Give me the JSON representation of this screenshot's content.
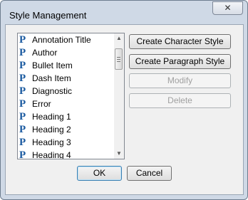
{
  "window": {
    "title": "Style Management",
    "close_label": "✕"
  },
  "styles_list": {
    "items": [
      {
        "icon": "P",
        "label": "Annotation Title"
      },
      {
        "icon": "P",
        "label": "Author"
      },
      {
        "icon": "P",
        "label": "Bullet Item"
      },
      {
        "icon": "P",
        "label": "Dash Item"
      },
      {
        "icon": "P",
        "label": "Diagnostic"
      },
      {
        "icon": "P",
        "label": "Error"
      },
      {
        "icon": "P",
        "label": "Heading 1"
      },
      {
        "icon": "P",
        "label": "Heading 2"
      },
      {
        "icon": "P",
        "label": "Heading 3"
      },
      {
        "icon": "P",
        "label": "Heading 4"
      }
    ]
  },
  "actions": {
    "create_character": "Create Character Style",
    "create_paragraph": "Create Paragraph Style",
    "modify": "Modify",
    "delete": "Delete"
  },
  "footer": {
    "ok": "OK",
    "cancel": "Cancel"
  },
  "icons": {
    "paragraph_style": "paragraph-style-icon",
    "close": "close-icon"
  },
  "colors": {
    "paragraph_icon": "#1a5aa0",
    "window_frame": "#cfd9e6",
    "client_bg": "#f0f0f0"
  }
}
